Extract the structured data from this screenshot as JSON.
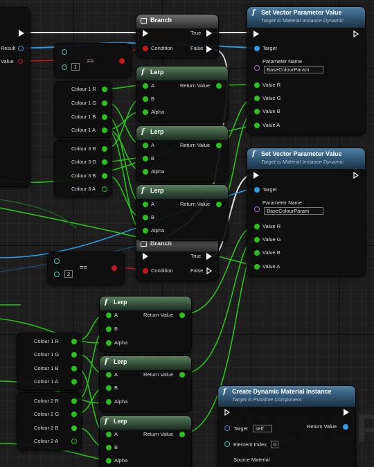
{
  "watermark": "BLUEPRINT",
  "left_node": {
    "result_label": "Result",
    "value_label": "Value"
  },
  "compare_nodes": [
    {
      "operator": "==",
      "value": "1"
    },
    {
      "operator": "==",
      "value": "2"
    }
  ],
  "branch_nodes": [
    {
      "title": "Branch",
      "condition": "Condition",
      "true_label": "True",
      "false_label": "False"
    },
    {
      "title": "Branch",
      "condition": "Condition",
      "true_label": "True",
      "false_label": "False"
    }
  ],
  "set_vector_nodes": [
    {
      "title": "Set Vector Parameter Value",
      "subtitle": "Target is Material Instance Dynamic",
      "target": "Target",
      "param_label": "Parameter Name",
      "param_value": "BaseColourParam",
      "value_r": "Value R",
      "value_g": "Value G",
      "value_b": "Value B",
      "value_a": "Value A"
    },
    {
      "title": "Set Vector Parameter Value",
      "subtitle": "Target is Material Instance Dynamic",
      "target": "Target",
      "param_label": "Parameter Name",
      "param_value": "BaseColourParam",
      "value_r": "Value R",
      "value_g": "Value G",
      "value_b": "Value B",
      "value_a": "Value A"
    }
  ],
  "lerp_nodes": [
    {
      "title": "Lerp",
      "a": "A",
      "b": "B",
      "alpha": "Alpha",
      "return": "Return Value"
    },
    {
      "title": "Lerp",
      "a": "A",
      "b": "B",
      "alpha": "Alpha",
      "return": "Return Value"
    },
    {
      "title": "Lerp",
      "a": "A",
      "b": "B",
      "alpha": "Alpha",
      "return": "Return Value"
    },
    {
      "title": "Lerp",
      "a": "A",
      "b": "B",
      "alpha": "Alpha",
      "return": "Return Value"
    },
    {
      "title": "Lerp",
      "a": "A",
      "b": "B",
      "alpha": "Alpha",
      "return": "Return Value"
    },
    {
      "title": "Lerp",
      "a": "A",
      "b": "B",
      "alpha": "Alpha",
      "return": "Return Value"
    }
  ],
  "break_nodes": [
    {
      "rows": [
        "Colour 1 R",
        "Colour 1 G",
        "Colour 1 B",
        "Colour 1 A"
      ]
    },
    {
      "rows": [
        "Colour 3 R",
        "Colour 3 G",
        "Colour 3 B",
        "Colour 3 A"
      ]
    },
    {
      "rows": [
        "Colour 1 R",
        "Colour 1 G",
        "Colour 1 B",
        "Colour 1 A"
      ]
    },
    {
      "rows": [
        "Colour 2 R",
        "Colour 2 G",
        "Colour 2 B",
        "Colour 2 A"
      ]
    }
  ],
  "create_dmi": {
    "title": "Create Dynamic Material Instance",
    "subtitle": "Target is Primitive Component",
    "target": "Target",
    "target_value": "self",
    "element_index": "Element Index",
    "element_value": "0",
    "source_material": "Source Material",
    "return": "Return Value"
  },
  "colors": {
    "float_pin": "#29c21b",
    "object_pin": "#2a9be6",
    "bool_pin": "#c41717",
    "lerp_header": "#3f6044",
    "function_header": "#2c4f6c",
    "branch_header": "#4a4a4a"
  }
}
